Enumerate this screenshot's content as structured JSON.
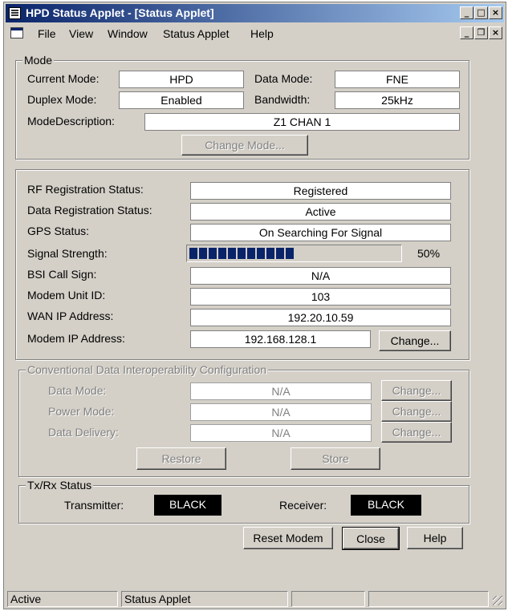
{
  "window": {
    "title": "HPD Status Applet - [Status Applet]"
  },
  "menu": [
    "File",
    "View",
    "Window",
    "Status Applet",
    "Help"
  ],
  "mode": {
    "group_title": "Mode",
    "current_mode_label": "Current Mode:",
    "current_mode_value": "HPD",
    "data_mode_label": "Data Mode:",
    "data_mode_value": "FNE",
    "duplex_mode_label": "Duplex Mode:",
    "duplex_mode_value": "Enabled",
    "bandwidth_label": "Bandwidth:",
    "bandwidth_value": "25kHz",
    "mode_description_label": "ModeDescription:",
    "mode_description_value": "Z1  CHAN 1",
    "change_mode_button": "Change Mode..."
  },
  "status": {
    "rf_registration_label": "RF Registration Status:",
    "rf_registration_value": "Registered",
    "data_registration_label": "Data Registration Status:",
    "data_registration_value": "Active",
    "gps_status_label": "GPS Status:",
    "gps_status_value": "On Searching For Signal",
    "signal_strength_label": "Signal Strength:",
    "signal_strength_percent": 50,
    "signal_strength_text": "50%",
    "signal_strength_segments": 11,
    "bsi_call_sign_label": "BSI Call Sign:",
    "bsi_call_sign_value": "N/A",
    "modem_unit_id_label": "Modem Unit ID:",
    "modem_unit_id_value": "103",
    "wan_ip_label": "WAN IP Address:",
    "wan_ip_value": "192.20.10.59",
    "modem_ip_label": "Modem IP Address:",
    "modem_ip_value": "192.168.128.1",
    "change_button": "Change..."
  },
  "conventional": {
    "group_title": "Conventional Data Interoperability Configuration",
    "data_mode_label": "Data Mode:",
    "data_mode_value": "N/A",
    "power_mode_label": "Power Mode:",
    "power_mode_value": "N/A",
    "data_delivery_label": "Data Delivery:",
    "data_delivery_value": "N/A",
    "change_button": "Change...",
    "restore_button": "Restore",
    "store_button": "Store"
  },
  "txrx": {
    "group_title": "Tx/Rx Status",
    "transmitter_label": "Transmitter:",
    "transmitter_value": "BLACK",
    "receiver_label": "Receiver:",
    "receiver_value": "BLACK"
  },
  "buttons": {
    "reset_modem": "Reset Modem",
    "close": "Close",
    "help": "Help"
  },
  "statusbar": [
    "Active",
    "Status Applet",
    "",
    ""
  ],
  "colors": {
    "title_start": "#0a246a",
    "title_end": "#a6caf0",
    "progress": "#0a246a",
    "face": "#d4d0c8"
  }
}
